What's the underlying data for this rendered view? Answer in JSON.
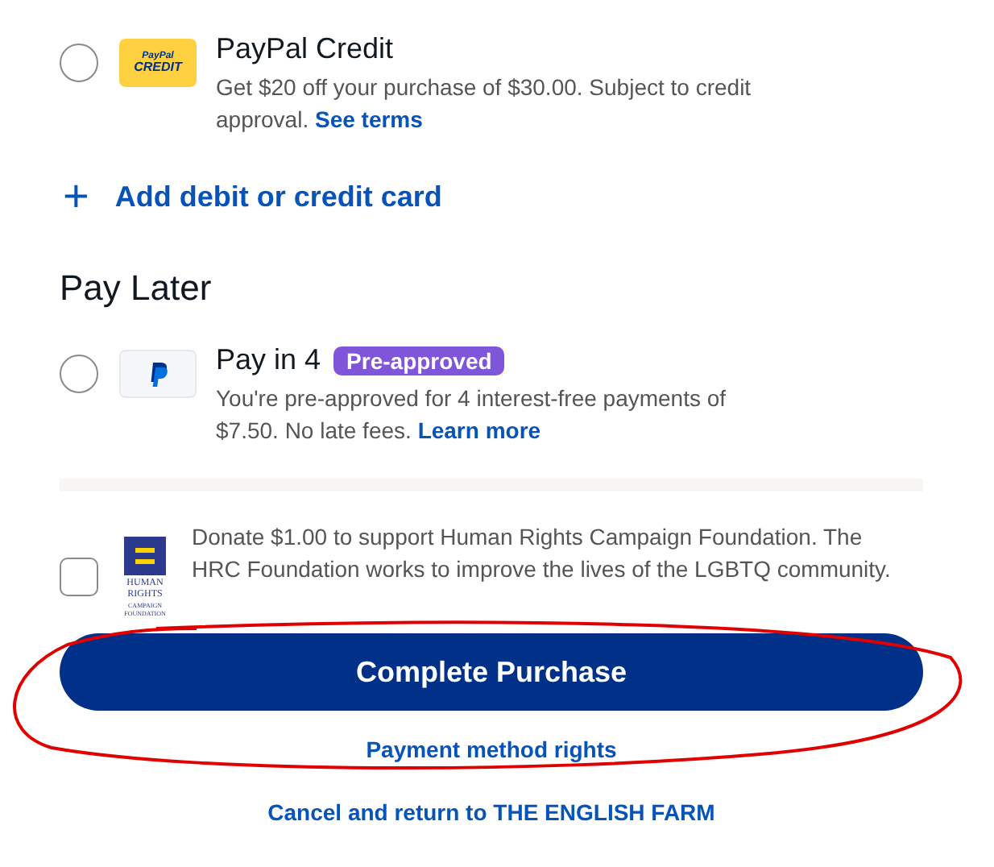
{
  "payment_options": [
    {
      "kind": "credit",
      "selected": false,
      "logo_lines": [
        "PayPal",
        "CREDIT"
      ],
      "title": "PayPal Credit",
      "description": "Get $20 off your purchase of $30.00. Subject to credit approval.",
      "link": "See terms"
    }
  ],
  "add_card": {
    "icon": "+",
    "label": "Add debit or credit card"
  },
  "pay_later": {
    "heading": "Pay Later",
    "options": [
      {
        "kind": "paypal",
        "selected": false,
        "title": "Pay in 4",
        "badge": "Pre-approved",
        "description": "You're pre-approved for 4 interest-free payments of $7.50. No late fees.",
        "link": "Learn more"
      }
    ]
  },
  "donation": {
    "checked": false,
    "logo_text": "HUMAN RIGHTS",
    "logo_subtext": "CAMPAIGN FOUNDATION",
    "text": "Donate $1.00 to support Human Rights Campaign Foundation. The HRC Foundation works to improve the lives of the LGBTQ community."
  },
  "complete_button": "Complete Purchase",
  "rights_link": "Payment method rights",
  "cancel_link": "Cancel and return to THE ENGLISH FARM"
}
